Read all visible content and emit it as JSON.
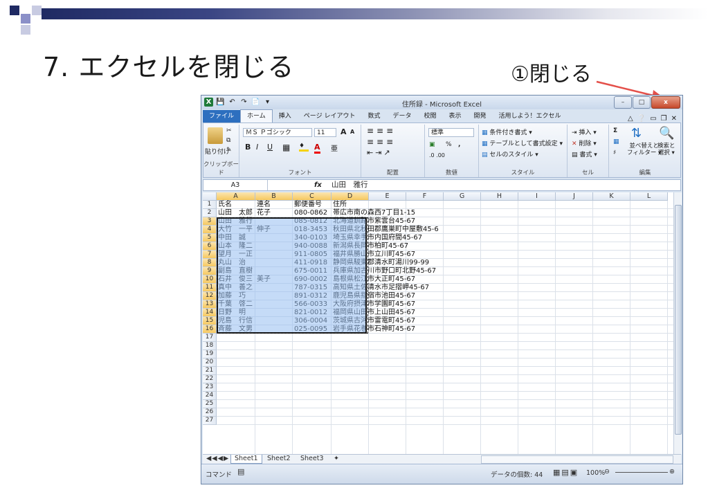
{
  "slide": {
    "title": "7. エクセルを閉じる",
    "callout": "①閉じる"
  },
  "colors": {
    "slide_bar_dark": "#1f2a63",
    "callout_arrow": "#e4504a",
    "file_tab": "#2d6fbf",
    "close_button": "#c6492c",
    "selection_fill": "#96bef0"
  },
  "excel": {
    "window_title": "住所録 - Microsoft Excel",
    "window_buttons": {
      "minimize": "–",
      "restore": "□",
      "close": "x"
    },
    "tabs": [
      "ファイル",
      "ホーム",
      "挿入",
      "ページ レイアウト",
      "数式",
      "データ",
      "校閲",
      "表示",
      "開発",
      "活用しよう！エクセル"
    ],
    "active_tab": "ホーム",
    "ribbon": {
      "clipboard": {
        "paste": "貼り付け",
        "label": "クリップボード"
      },
      "font": {
        "name": "ＭＳ Ｐゴシック",
        "size": "11",
        "grow": "A",
        "shrink": "A",
        "bold": "B",
        "italic": "I",
        "underline": "U",
        "label": "フォント"
      },
      "alignment": {
        "label": "配置"
      },
      "number": {
        "format": "標準",
        "percent": "%",
        "comma": ",",
        "label": "数値"
      },
      "styles": {
        "conditional": "条件付き書式",
        "table": "テーブルとして書式設定",
        "cell_styles": "セルのスタイル",
        "label": "スタイル"
      },
      "cells": {
        "insert": "挿入",
        "delete": "削除",
        "format": "書式",
        "label": "セル"
      },
      "editing": {
        "sigma": "Σ",
        "sort_line1": "並べ替えと",
        "sort_line2": "フィルター",
        "find_line1": "検索と",
        "find_line2": "選択",
        "label": "編集"
      }
    },
    "name_box": "A3",
    "fx": "fx",
    "formula_value": "山田　雅行",
    "columns": [
      "A",
      "B",
      "C",
      "D",
      "E",
      "F",
      "G",
      "H",
      "I",
      "J",
      "K",
      "L"
    ],
    "row_numbers": [
      "1",
      "2",
      "3",
      "4",
      "5",
      "6",
      "7",
      "8",
      "9",
      "10",
      "11",
      "12",
      "13",
      "14",
      "15",
      "16",
      "17",
      "18",
      "19",
      "20",
      "21",
      "22",
      "23",
      "24",
      "25",
      "26",
      "27"
    ],
    "rows": [
      {
        "a": "氏名",
        "b": "連名",
        "c": "郵便番号",
        "d": "住所"
      },
      {
        "a": "山田　太郎",
        "b": "花子",
        "c": "080-0862",
        "d": "帯広市南の森西7丁目1-15"
      },
      {
        "a": "山田　雅行",
        "b": "",
        "c": "085-0812",
        "d": "北海道釧路市紫雲台45-67"
      },
      {
        "a": "大竹　一平",
        "b": "伸子",
        "c": "018-3453",
        "d": "秋田県北秋田郡鷹巣町中屋敷45-6"
      },
      {
        "a": "中田　誠",
        "b": "",
        "c": "340-0103",
        "d": "埼玉県幸手市内国府間45-67"
      },
      {
        "a": "山本　隆二",
        "b": "",
        "c": "940-0088",
        "d": "新潟県長岡市柏町45-67"
      },
      {
        "a": "望月　一正",
        "b": "",
        "c": "911-0805",
        "d": "福井県勝山市立川町45-67"
      },
      {
        "a": "丸山　治",
        "b": "",
        "c": "411-0918",
        "d": "静岡県駿東郡清水町湯川99-99"
      },
      {
        "a": "副島　直樹",
        "b": "",
        "c": "675-0011",
        "d": "兵庫県加古川市野口町北野45-67"
      },
      {
        "a": "石井　俊三",
        "b": "美子",
        "c": "690-0002",
        "d": "島根県松江市大正町45-67"
      },
      {
        "a": "真中　善之",
        "b": "",
        "c": "787-0315",
        "d": "高知県土佐清水市足摺岬45-67"
      },
      {
        "a": "加藤　巧",
        "b": "",
        "c": "891-0312",
        "d": "鹿児島県指宿市池田45-67"
      },
      {
        "a": "千葉　啓二",
        "b": "",
        "c": "566-0033",
        "d": "大阪府摂津市学園町45-67"
      },
      {
        "a": "日野　明",
        "b": "",
        "c": "821-0012",
        "d": "福岡県山田市上山田45-67"
      },
      {
        "a": "児島　行信",
        "b": "",
        "c": "306-0004",
        "d": "茨城県古河市雷電町45-67"
      },
      {
        "a": "斉藤　文男",
        "b": "",
        "c": "025-0095",
        "d": "岩手県花巻市石神町45-67"
      }
    ],
    "sheets": [
      "Sheet1",
      "Sheet2",
      "Sheet3"
    ],
    "active_sheet": "Sheet1",
    "status": {
      "mode": "コマンド",
      "count": "データの個数: 44",
      "zoom": "100%"
    }
  }
}
